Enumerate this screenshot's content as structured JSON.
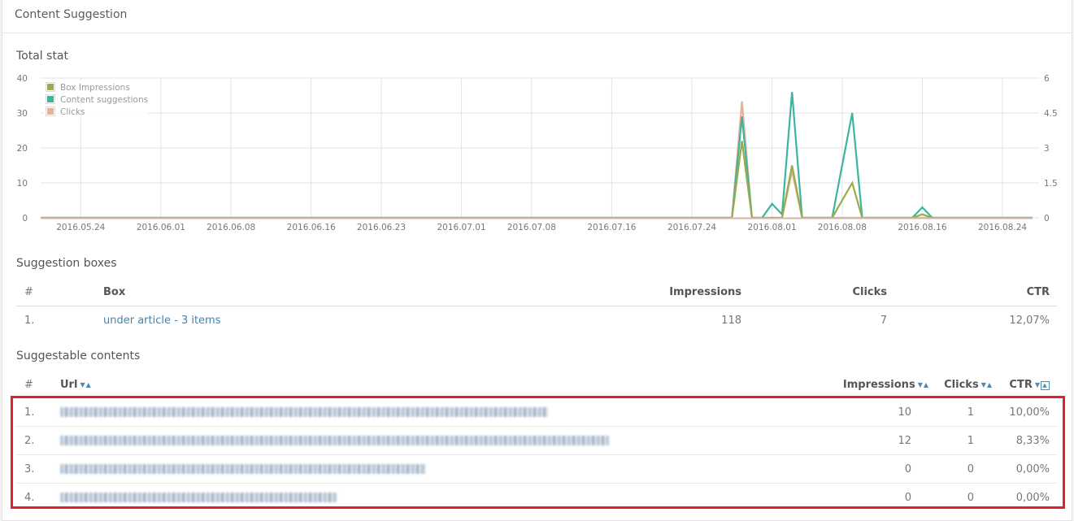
{
  "card": {
    "title": "Content Suggestion"
  },
  "sections": {
    "total_stat": "Total stat",
    "suggestion_boxes": "Suggestion boxes",
    "suggestable_contents": "Suggestable contents"
  },
  "chart_data": {
    "type": "line",
    "title": "Total stat",
    "xlabel": "",
    "ylabel": "",
    "x_start": "2016.05.20",
    "x_end": "2016.08.27",
    "x_ticks": [
      "2016.05.24",
      "2016.06.01",
      "2016.06.08",
      "2016.06.16",
      "2016.06.23",
      "2016.07.01",
      "2016.07.08",
      "2016.07.16",
      "2016.07.24",
      "2016.08.01",
      "2016.08.08",
      "2016.08.16",
      "2016.08.24"
    ],
    "y_left": {
      "range": [
        0,
        40
      ],
      "ticks": [
        "0",
        "10",
        "20",
        "30",
        "40"
      ]
    },
    "y_right": {
      "range": [
        0,
        6
      ],
      "ticks": [
        "0",
        "1.5",
        "3",
        "4.5",
        "6"
      ]
    },
    "grid": true,
    "legend": "top-left",
    "series": [
      {
        "name": "Box Impressions",
        "color": "#9aac4a",
        "axis": "left",
        "points": [
          [
            "2016.05.20",
            0
          ],
          [
            "2016.07.28",
            0
          ],
          [
            "2016.07.29",
            22
          ],
          [
            "2016.07.30",
            0
          ],
          [
            "2016.08.02",
            0
          ],
          [
            "2016.08.03",
            15
          ],
          [
            "2016.08.04",
            0
          ],
          [
            "2016.08.07",
            0
          ],
          [
            "2016.08.09",
            10
          ],
          [
            "2016.08.10",
            0
          ],
          [
            "2016.08.15",
            0
          ],
          [
            "2016.08.16",
            1
          ],
          [
            "2016.08.17",
            0
          ],
          [
            "2016.08.27",
            0
          ]
        ]
      },
      {
        "name": "Content suggestions",
        "color": "#3cb4a0",
        "axis": "left",
        "points": [
          [
            "2016.05.20",
            0
          ],
          [
            "2016.07.28",
            0
          ],
          [
            "2016.07.29",
            29
          ],
          [
            "2016.07.30",
            0
          ],
          [
            "2016.07.31",
            0
          ],
          [
            "2016.08.01",
            4
          ],
          [
            "2016.08.02",
            1
          ],
          [
            "2016.08.03",
            36
          ],
          [
            "2016.08.04",
            0
          ],
          [
            "2016.08.07",
            0
          ],
          [
            "2016.08.09",
            30
          ],
          [
            "2016.08.10",
            0
          ],
          [
            "2016.08.15",
            0
          ],
          [
            "2016.08.16",
            3
          ],
          [
            "2016.08.17",
            0
          ],
          [
            "2016.08.27",
            0
          ]
        ]
      },
      {
        "name": "Clicks",
        "color": "#e8b09a",
        "axis": "right",
        "points": [
          [
            "2016.05.20",
            0
          ],
          [
            "2016.07.28",
            0
          ],
          [
            "2016.07.29",
            5
          ],
          [
            "2016.07.30",
            0
          ],
          [
            "2016.08.02",
            0
          ],
          [
            "2016.08.03",
            2
          ],
          [
            "2016.08.04",
            0
          ],
          [
            "2016.08.27",
            0
          ]
        ]
      }
    ]
  },
  "suggestion_boxes": {
    "headers": {
      "num": "#",
      "box": "Box",
      "impressions": "Impressions",
      "clicks": "Clicks",
      "ctr": "CTR"
    },
    "rows": [
      {
        "num": "1.",
        "box": "under article - 3 items",
        "impressions": "118",
        "clicks": "7",
        "ctr": "12,07%"
      }
    ]
  },
  "suggestable_contents": {
    "headers": {
      "num": "#",
      "url": "Url",
      "impressions": "Impressions",
      "clicks": "Clicks",
      "ctr": "CTR"
    },
    "sort_icons": {
      "desc": "▼",
      "asc": "▲"
    },
    "active_sort": "CTR ascending",
    "rows": [
      {
        "num": "1.",
        "url": "[blurred url]",
        "impressions": "10",
        "clicks": "1",
        "ctr": "10,00%"
      },
      {
        "num": "2.",
        "url": "[blurred url]",
        "impressions": "12",
        "clicks": "1",
        "ctr": "8,33%"
      },
      {
        "num": "3.",
        "url": "[blurred url]",
        "impressions": "0",
        "clicks": "0",
        "ctr": "0,00%"
      },
      {
        "num": "4.",
        "url": "[blurred url]",
        "impressions": "0",
        "clicks": "0",
        "ctr": "0,00%"
      }
    ]
  },
  "highlight": {
    "color": "#e0202a"
  }
}
